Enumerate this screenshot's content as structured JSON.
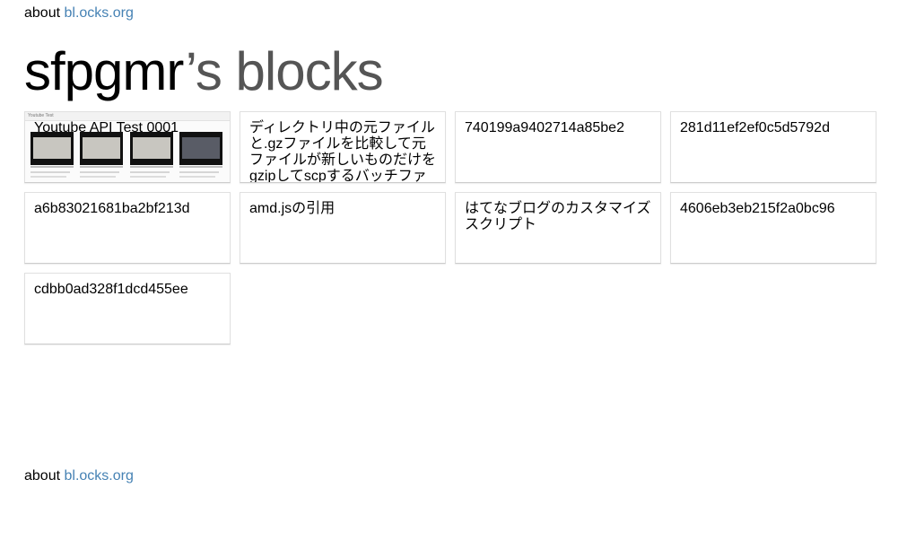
{
  "header": {
    "about_text": "about",
    "about_link": "bl.ocks.org"
  },
  "title": {
    "owner": "sfpgmr",
    "suffix": "’s blocks"
  },
  "thumbnail": {
    "window_title": "Youtube Test"
  },
  "blocks": [
    {
      "description": "Youtube API Test 0001",
      "has_thumbnail": true
    },
    {
      "description": "ディレクトリ中の元ファイルと.gzファイルを比較して元ファイルが新しいものだけをgzipしてscpするバッチファイル"
    },
    {
      "description": "740199a9402714a85be2"
    },
    {
      "description": "281d11ef2ef0c5d5792d"
    },
    {
      "description": "a6b83021681ba2bf213d"
    },
    {
      "description": "amd.jsの引用"
    },
    {
      "description": "はてなブログのカスタマイズスクリプト"
    },
    {
      "description": "4606eb3eb215f2a0bc96"
    },
    {
      "description": "cdbb0ad328f1dcd455ee"
    }
  ],
  "footer": {
    "about_text": "about",
    "about_link": "bl.ocks.org"
  }
}
